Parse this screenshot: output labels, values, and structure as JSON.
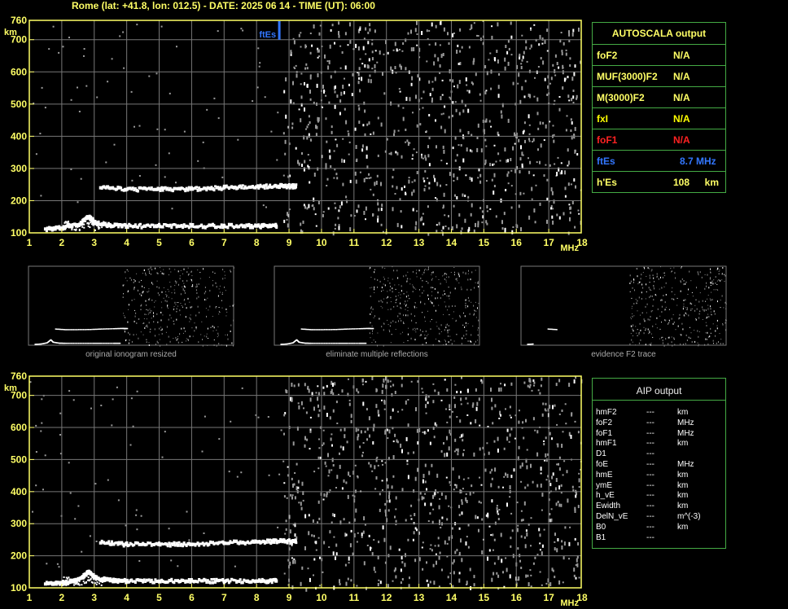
{
  "header": {
    "title": "Rome (lat: +41.8, lon: 012.5) - DATE: 2025 06 14 - TIME (UT): 06:00"
  },
  "colors": {
    "label": "#ffff66",
    "grid": "#777777",
    "frame": "#ffff66",
    "trace": "#ffffff",
    "noise": "#999999",
    "ftes": "#3377ff",
    "fof1": "#ff2222",
    "fxi": "#ffff00",
    "panel_border": "#44aa44"
  },
  "axes": {
    "y_unit": "km",
    "x_unit": "MHz",
    "y_ticks": [
      "760",
      "700",
      "600",
      "500",
      "400",
      "300",
      "200",
      "100"
    ],
    "x_ticks": [
      "1",
      "2",
      "3",
      "4",
      "5",
      "6",
      "7",
      "8",
      "9",
      "10",
      "11",
      "12",
      "13",
      "14",
      "15",
      "16",
      "17",
      "18"
    ]
  },
  "chart_data": [
    {
      "type": "scatter",
      "title": "",
      "xlabel": "MHz",
      "ylabel": "km",
      "xlim": [
        1,
        18
      ],
      "ylim": [
        100,
        760
      ],
      "annotation": "ftEs",
      "annotation_freq": 8.7,
      "series": [
        {
          "x": [
            1.5,
            2.0,
            2.5,
            2.8,
            3.0,
            3.5,
            4.0,
            5.0,
            6.0,
            7.0,
            8.0,
            8.6
          ],
          "y": [
            112,
            115,
            125,
            150,
            130,
            122,
            121,
            121,
            121,
            121,
            121,
            121
          ]
        },
        {
          "x": [
            3.2,
            4.0,
            5.0,
            6.0,
            7.0,
            8.0,
            8.7,
            9.2
          ],
          "y": [
            240,
            235,
            235,
            236,
            240,
            243,
            245,
            244
          ]
        }
      ]
    },
    {
      "type": "scatter",
      "title": "",
      "xlabel": "MHz",
      "ylabel": "km",
      "xlim": [
        1,
        18
      ],
      "ylim": [
        100,
        760
      ],
      "series": [
        {
          "x": [
            1.5,
            2.0,
            2.5,
            2.8,
            3.0,
            3.5,
            4.0,
            5.0,
            6.0,
            7.0,
            8.0,
            8.6
          ],
          "y": [
            112,
            115,
            125,
            150,
            130,
            122,
            121,
            121,
            121,
            121,
            121,
            121
          ]
        },
        {
          "x": [
            3.2,
            4.0,
            5.0,
            6.0,
            7.0,
            8.0,
            8.7,
            9.2
          ],
          "y": [
            240,
            235,
            235,
            236,
            240,
            243,
            245,
            244
          ]
        }
      ]
    }
  ],
  "autoscala": {
    "title": "AUTOSCALA output",
    "rows": [
      {
        "key": "foF2",
        "value": "N/A",
        "unit": "",
        "color": "#ffff66"
      },
      {
        "key": "MUF(3000)F2",
        "value": "N/A",
        "unit": "",
        "color": "#ffff66"
      },
      {
        "key": "M(3000)F2",
        "value": "N/A",
        "unit": "",
        "color": "#ffff66"
      },
      {
        "key": "fxI",
        "value": "N/A",
        "unit": "",
        "color": "#ffff00"
      },
      {
        "key": "foF1",
        "value": "N/A",
        "unit": "",
        "color": "#ff2222"
      },
      {
        "key": "ftEs",
        "value": "8.7 MHz",
        "unit": "",
        "color": "#3377ff"
      },
      {
        "key": "h'Es",
        "value": "108",
        "unit": "km",
        "color": "#ffff66"
      }
    ]
  },
  "thumbnails": [
    {
      "caption": "original ionogram resized"
    },
    {
      "caption": "eliminate multiple reflections"
    },
    {
      "caption": "evidence F2 trace"
    }
  ],
  "aip": {
    "title": "AIP output",
    "rows": [
      {
        "key": "hmF2",
        "value": "---",
        "unit": "km"
      },
      {
        "key": "foF2",
        "value": "---",
        "unit": "MHz"
      },
      {
        "key": "foF1",
        "value": "---",
        "unit": "MHz"
      },
      {
        "key": "hmF1",
        "value": "---",
        "unit": "km"
      },
      {
        "key": "D1",
        "value": "---",
        "unit": ""
      },
      {
        "key": "foE",
        "value": "---",
        "unit": "MHz"
      },
      {
        "key": "hmE",
        "value": "---",
        "unit": "km"
      },
      {
        "key": "ymE",
        "value": "---",
        "unit": "km"
      },
      {
        "key": "h_vE",
        "value": "---",
        "unit": "km"
      },
      {
        "key": "Ewidth",
        "value": "---",
        "unit": "km"
      },
      {
        "key": "DelN_vE",
        "value": "---",
        "unit": "m^(-3)"
      },
      {
        "key": "B0",
        "value": "---",
        "unit": "km"
      },
      {
        "key": "B1",
        "value": "---",
        "unit": ""
      }
    ]
  }
}
